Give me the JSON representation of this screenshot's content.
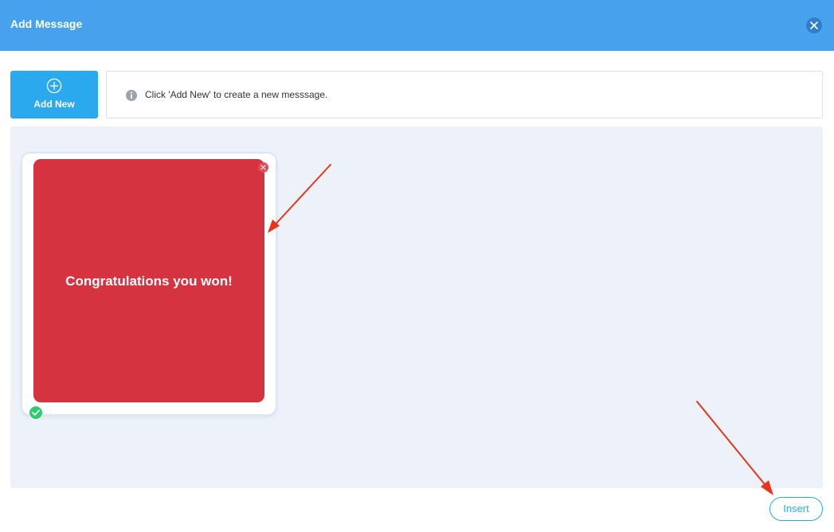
{
  "header": {
    "title": "Add Message",
    "close_icon": "close-icon"
  },
  "toolbar": {
    "add_new_label": "Add New",
    "add_new_icon": "plus-circle-icon",
    "info_icon": "info-icon",
    "info_text": "Click 'Add New' to create a new messsage."
  },
  "gallery": {
    "messages": [
      {
        "text": "Congratulations you won!",
        "background_color": "#d63341",
        "selected": true,
        "remove_icon": "close-icon",
        "selected_icon": "check-circle-icon"
      }
    ]
  },
  "footer": {
    "insert_label": "Insert"
  },
  "colors": {
    "header": "#47a1ec",
    "accent": "#2aa9ee",
    "gallery_bg": "#edf2f9",
    "annotation_arrow": "#e8341c",
    "selected_check": "#2ecc71"
  }
}
